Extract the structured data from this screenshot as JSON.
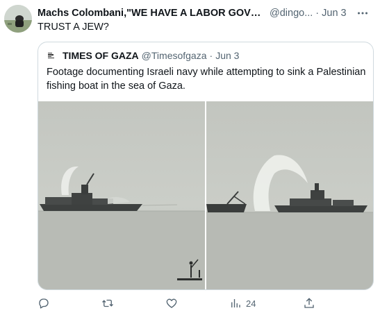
{
  "tweet": {
    "display_name": "Machs Colombani,\"WE HAVE A LABOR GOVERN...",
    "handle": "@dingo...",
    "separator": "·",
    "time": "Jun 3",
    "text": "TRUST A JEW?",
    "avatar_icon": "avatar-photo"
  },
  "quoted": {
    "display_name": "TIMES OF GAZA",
    "handle": "@Timesofgaza",
    "separator": "·",
    "time": "Jun 3",
    "text": "Footage documenting Israeli navy while attempting to sink a Palestinian fishing boat in the sea of Gaza.",
    "avatar_icon": "times-of-gaza-logo",
    "media": [
      {
        "name": "photo-left",
        "icon": "navy-ship-water-cannon"
      },
      {
        "name": "photo-right",
        "icon": "navy-ship-water-cannon"
      }
    ]
  },
  "actions": {
    "reply_icon": "reply-icon",
    "retweet_icon": "retweet-icon",
    "like_icon": "heart-icon",
    "views_icon": "views-icon",
    "views_count": "24",
    "share_icon": "share-icon",
    "more_icon": "more-icon"
  },
  "colors": {
    "text_primary": "#0f1419",
    "text_secondary": "#536471",
    "border": "#cfd9de",
    "sea_sky": "#c9ccc7"
  }
}
